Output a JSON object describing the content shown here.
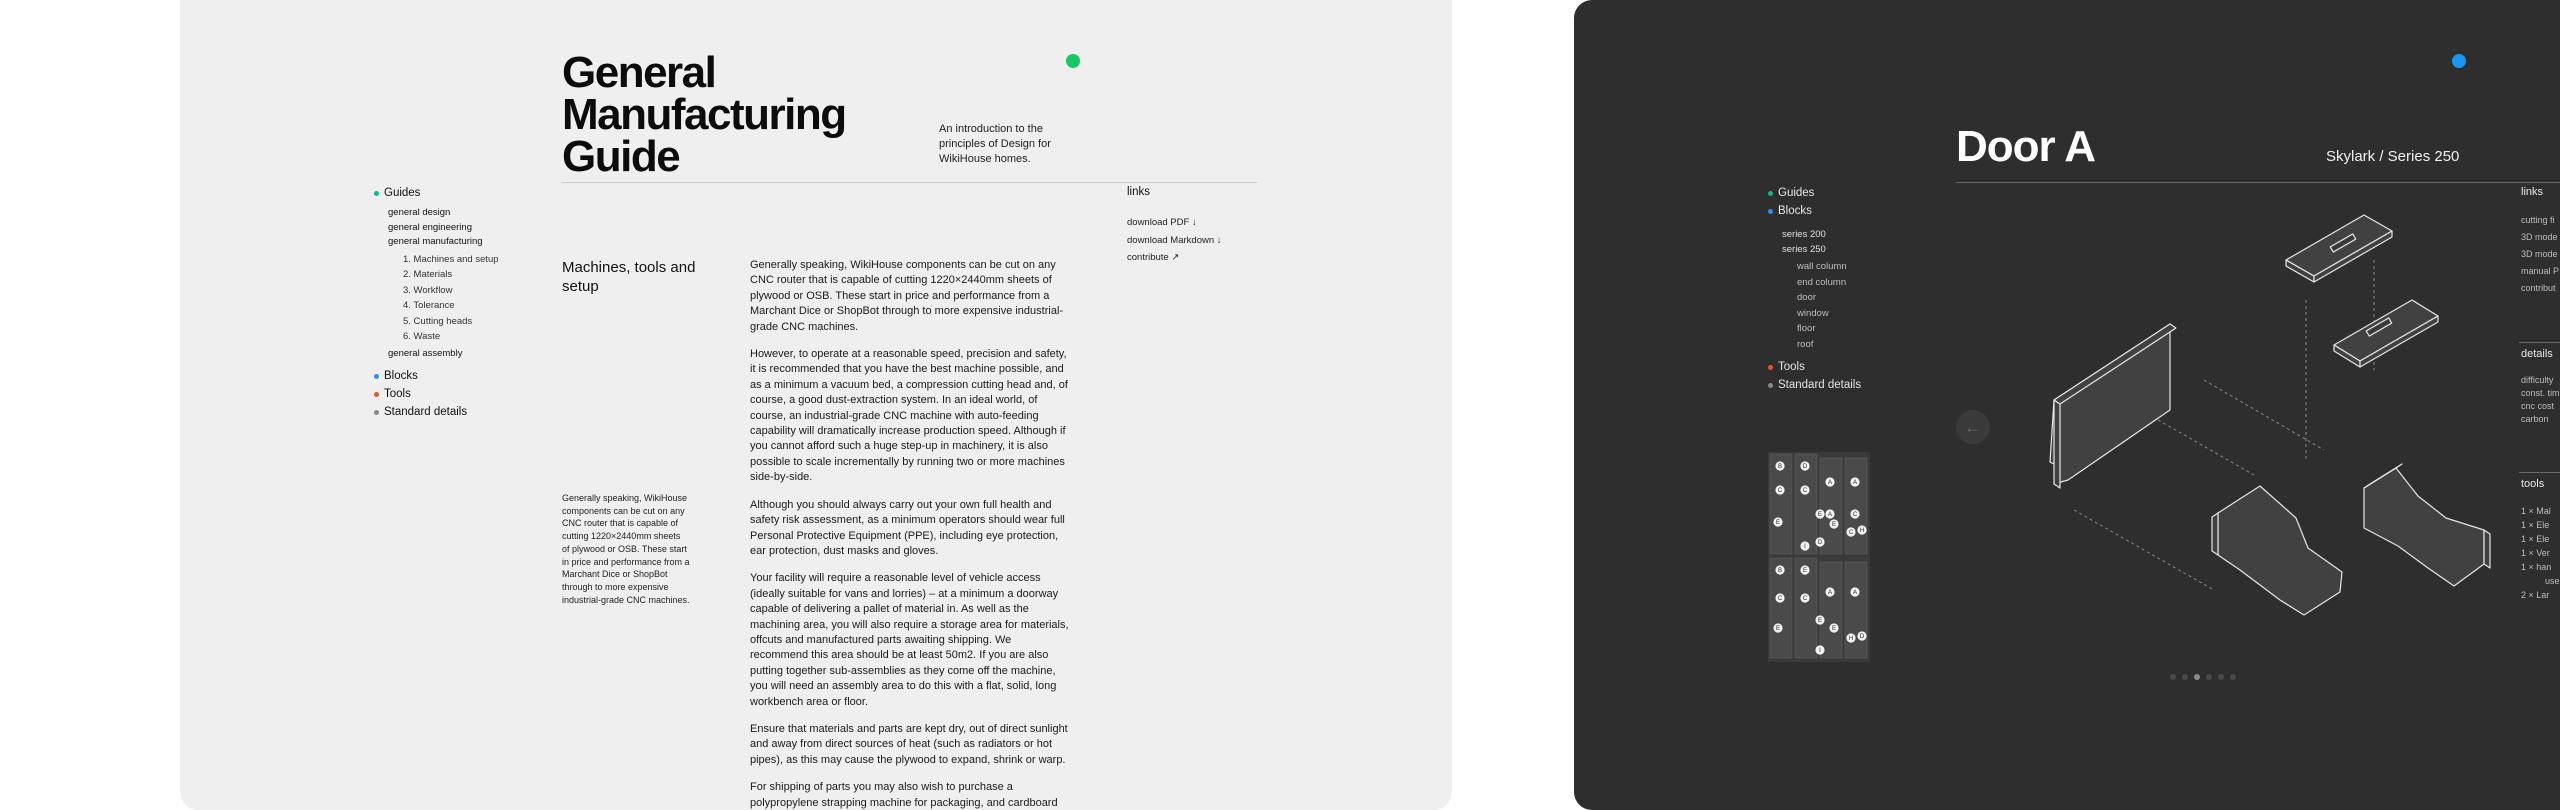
{
  "colors": {
    "green": "#17c964",
    "blue": "#1597f5",
    "guides_dot": "#16b38a",
    "blocks_dot": "#2f8ef5",
    "tools_dot": "#e8542a",
    "standard_dot": "#8a8a8a"
  },
  "guide": {
    "title_lines": [
      "General",
      "Manufacturing",
      "Guide"
    ],
    "intro": "An introduction to the principles of Design for WikiHouse homes.",
    "nav": {
      "guides": "Guides",
      "sub": [
        "general design",
        "general engineering",
        "general manufacturing"
      ],
      "steps": [
        "1. Machines and setup",
        "2. Materials",
        "3. Workflow",
        "4. Tolerance",
        "5. Cutting heads",
        "6. Waste"
      ],
      "assembly": "general assembly",
      "blocks": "Blocks",
      "tools": "Tools",
      "standard": "Standard details"
    },
    "section_title": "Machines, tools and setup",
    "paragraphs": [
      "Generally speaking, WikiHouse components can be cut on any CNC router that is capable of cutting 1220×2440mm sheets of plywood or OSB. These  start in price and performance from a Marchant Dice or ShopBot through to more expensive industrial-grade CNC machines.",
      "However, to operate at a reasonable speed, precision and safety, it is recommended that you have the best machine possible, and as a minimum a vacuum bed, a compression cutting head and, of course, a good dust-extraction system. In an ideal world, of course, an industrial-grade CNC machine with auto-feeding capability will dramatically increase production speed. Although if you cannot afford such a huge step-up in machinery, it is also possible to scale incrementally by running two or more machines side-by-side.",
      "Although you should always carry out your own full health and safety risk assessment, as a minimum operators should wear full Personal Protective Equipment (PPE), including eye protection, ear protection, dust masks and gloves.",
      "Your facility will require a reasonable level of vehicle access (ideally suitable for vans and lorries) – at a minimum a doorway capable of delivering a pallet of material in. As well as the machining area, you will also require a storage area for materials, offcuts and manufactured parts awaiting shipping. We recommend this area should be at least 50m2. If you are also putting together sub-assemblies as they come off the machine, you will need an assembly area to do this with a flat, solid, long workbench area or floor.",
      "Ensure that materials and parts are kept dry, out of direct sunlight and away from direct sources of heat (such as radiators or hot pipes), as this may cause the plywood to expand, shrink or warp.",
      "For shipping of parts you may also wish to purchase a polypropylene strapping machine for packaging, and cardboard"
    ],
    "side_note": "Generally speaking, WikiHouse components can be cut on any CNC router that is capable of cutting 1220×2440mm sheets of plywood or OSB. These  start in price and performance from a Marchant Dice or ShopBot through to more expensive industrial-grade CNC machines.",
    "links_title": "links",
    "links": [
      "download PDF ↓",
      "download Markdown ↓",
      "contribute ↗"
    ]
  },
  "door": {
    "title": "Door A",
    "series_label": "Skylark / Series 250",
    "nav": {
      "guides": "Guides",
      "blocks": "Blocks",
      "series": [
        "series 200",
        "series 250"
      ],
      "items": [
        "wall column",
        "end column",
        "door",
        "window",
        "floor",
        "roof"
      ],
      "tools": "Tools",
      "standard": "Standard details"
    },
    "links_title": "links",
    "links": [
      "cutting fi",
      "3D mode",
      "3D mode",
      "manual P",
      "contribut"
    ],
    "details_title": "details",
    "details": [
      "difficulty",
      "const. tim",
      "cnc cost",
      "carbon"
    ],
    "tools_title": "tools",
    "tools": [
      "1 × Mal",
      "1 × Ele",
      "1 × Ele",
      "1 × Ver",
      "1 × han",
      "use",
      "2 × Lar"
    ],
    "prev_icon": "←",
    "next_icon": "→",
    "sheet_labels": [
      "B",
      "D",
      "A",
      "A",
      "C",
      "C",
      "A",
      "C",
      "E",
      "E",
      "E",
      "C",
      "H",
      "D",
      "I",
      "B",
      "E",
      "A",
      "A",
      "C",
      "C",
      "E",
      "E",
      "E",
      "H",
      "D",
      "I"
    ]
  }
}
